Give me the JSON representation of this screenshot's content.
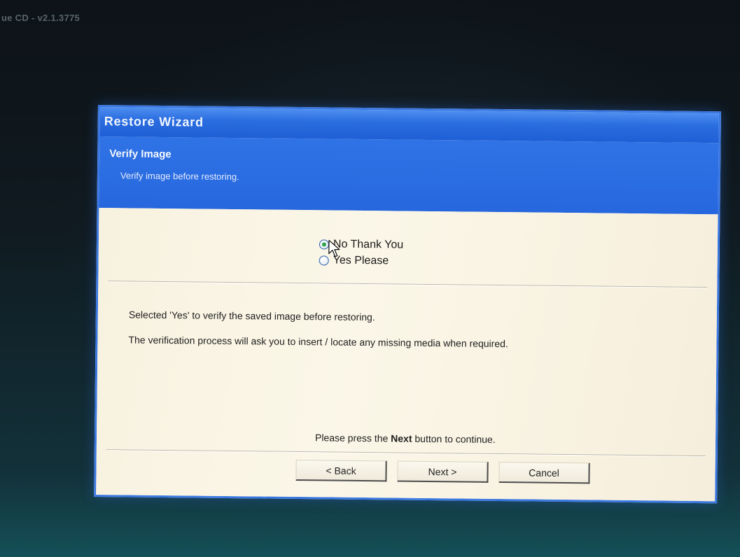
{
  "screen": {
    "top_title": "ue CD - v2.1.3775"
  },
  "wizard": {
    "title": "Restore Wizard",
    "header": {
      "title": "Verify Image",
      "subtitle": "Verify image before restoring."
    },
    "options": [
      {
        "label": "No Thank You",
        "checked": true
      },
      {
        "label": "Yes Please",
        "checked": false
      }
    ],
    "info_lines": [
      "Selected 'Yes' to verify the saved image before restoring.",
      "The verification process will ask you to insert / locate any missing media when required."
    ],
    "press_next": {
      "prefix": "Please press the ",
      "bold": "Next",
      "suffix": " button to continue."
    },
    "buttons": {
      "back": "< Back",
      "next": "Next >",
      "cancel": "Cancel"
    }
  },
  "icons": {
    "cursor": "arrow-cursor-icon",
    "radio_checked": "radio-checked-icon",
    "radio_unchecked": "radio-unchecked-icon"
  },
  "colors": {
    "header_blue": "#2767de",
    "titlebar_blue": "#1f5fd6",
    "body_bg": "#fbf7e8",
    "radio_dot": "#2aa34a"
  }
}
